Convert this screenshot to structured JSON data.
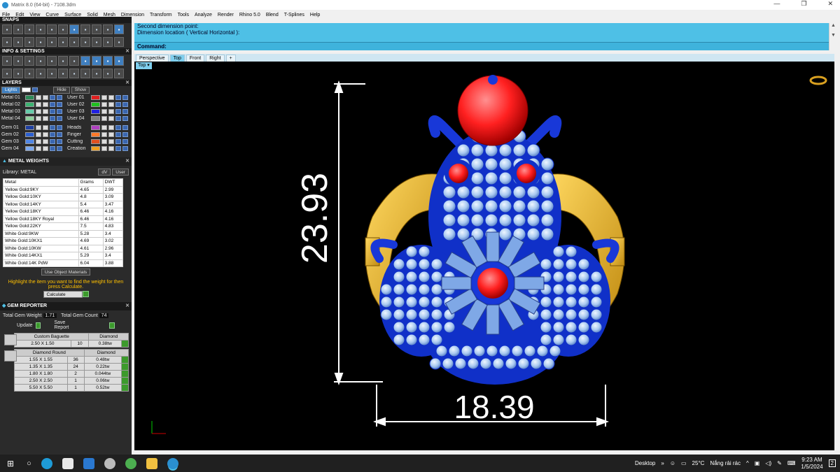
{
  "window": {
    "title": "Matrix 8.0 (64-bit) - 7108.3dm",
    "minimize": "—",
    "restore": "❐",
    "close": "✕"
  },
  "menu": [
    "File",
    "Edit",
    "View",
    "Curve",
    "Surface",
    "Solid",
    "Mesh",
    "Dimension",
    "Transform",
    "Tools",
    "Analyze",
    "Render",
    "Rhino 5.0",
    "Blend",
    "T-Splines",
    "Help"
  ],
  "panel": {
    "snaps": "SNAPS",
    "info_settings": "INFO & SETTINGS",
    "layers": "LAYERS",
    "lights": "Lights",
    "hide": "Hide",
    "show": "Show",
    "layers_left": [
      {
        "name": "Metal 01",
        "color": "#2e8b57"
      },
      {
        "name": "Metal 02",
        "color": "#3cb371"
      },
      {
        "name": "Metal 03",
        "color": "#66cdaa"
      },
      {
        "name": "Metal 04",
        "color": "#8fd19e"
      },
      {
        "name": "Gem 01",
        "color": "#1f3fa0"
      },
      {
        "name": "Gem 02",
        "color": "#2b5fd0"
      },
      {
        "name": "Gem 03",
        "color": "#4f86e6"
      },
      {
        "name": "Gem 04",
        "color": "#7aa8f0"
      }
    ],
    "layers_right": [
      {
        "name": "User 01",
        "color": "#e02020"
      },
      {
        "name": "User 02",
        "color": "#20c020"
      },
      {
        "name": "User 03",
        "color": "#2020e0"
      },
      {
        "name": "User 04",
        "color": "#808080"
      },
      {
        "name": "Heads",
        "color": "#b040c0"
      },
      {
        "name": "Finger",
        "color": "#ff7a2a"
      },
      {
        "name": "Cutting",
        "color": "#e05020"
      },
      {
        "name": "Creation",
        "color": "#f0a020"
      }
    ],
    "metal_weights": "METAL WEIGHTS",
    "library": "Library: METAL",
    "lib_btn1": "dV",
    "lib_btn2": "User",
    "metal_headers": [
      "Metal",
      "Grams",
      "DWT"
    ],
    "metals": [
      [
        "Yellow Gold:9KY",
        "4.65",
        "2.99"
      ],
      [
        "Yellow Gold:10KY",
        "4.8",
        "3.09"
      ],
      [
        "Yellow Gold:14KY",
        "5.4",
        "3.47"
      ],
      [
        "Yellow Gold:18KY",
        "6.46",
        "4.16"
      ],
      [
        "Yellow Gold:18KY Royal",
        "6.46",
        "4.16"
      ],
      [
        "Yellow Gold:22KY",
        "7.5",
        "4.83"
      ],
      [
        "White Gold:9KW",
        "5.28",
        "3.4"
      ],
      [
        "White Gold:10KX1",
        "4.69",
        "3.02"
      ],
      [
        "White Gold:10KW",
        "4.61",
        "2.96"
      ],
      [
        "White Gold:14KX1",
        "5.29",
        "3.4"
      ],
      [
        "White Gold:14K PdW",
        "6.04",
        "3.88"
      ]
    ],
    "use_object_materials": "Use Object Materials",
    "hint": "Highlight the item you want to find the weight for then press Calculate.",
    "calculate": "Calculate",
    "gem_reporter": "GEM REPORTER",
    "total_gem_weight_label": "Total Gem Weight",
    "total_gem_weight": "1.71",
    "total_gem_count_label": "Total Gem Count",
    "total_gem_count": "74",
    "update": "Update",
    "save_report": "Save Report",
    "gem_groups": [
      {
        "type": "Custom Baguette",
        "material": "Diamond",
        "rows": [
          [
            "2.50 X 1.50",
            "10",
            "0.38tw"
          ]
        ]
      },
      {
        "type": "Diamond Round",
        "material": "Diamond",
        "rows": [
          [
            "1.55 X 1.55",
            "36",
            "0.48tw"
          ],
          [
            "1.35 X 1.35",
            "24",
            "0.22tw"
          ],
          [
            "1.80 X 1.80",
            "2",
            "0.044tw"
          ],
          [
            "2.50 X 2.50",
            "1",
            "0.06tw"
          ],
          [
            "5.50 X 5.50",
            "1",
            "0.52tw"
          ]
        ]
      }
    ]
  },
  "command": {
    "line1": "Second dimension point:",
    "line2": "Dimension location ( Vertical  Horizontal ):",
    "prompt": "Command:"
  },
  "viewport_tabs": [
    "Perspective",
    "Top",
    "Front",
    "Right",
    "+"
  ],
  "active_view": "Top",
  "dims": {
    "vertical": "23.93",
    "horizontal": "18.39"
  },
  "taskbar": {
    "desktop": "Desktop",
    "temp": "25°C",
    "weather": "Nắng rải rác",
    "time": "9:23 AM",
    "date": "1/5/2024",
    "notif": "2"
  }
}
